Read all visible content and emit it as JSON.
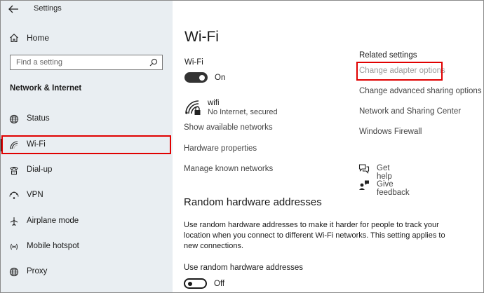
{
  "window": {
    "title": "Settings"
  },
  "sidebar": {
    "home_label": "Home",
    "search_placeholder": "Find a setting",
    "section_title": "Network & Internet",
    "items": [
      {
        "label": "Status",
        "icon": "globe-icon"
      },
      {
        "label": "Wi-Fi",
        "icon": "wifi-icon"
      },
      {
        "label": "Dial-up",
        "icon": "phone-icon"
      },
      {
        "label": "VPN",
        "icon": "vpn-icon"
      },
      {
        "label": "Airplane mode",
        "icon": "airplane-icon"
      },
      {
        "label": "Mobile hotspot",
        "icon": "hotspot-icon"
      },
      {
        "label": "Proxy",
        "icon": "globe-icon"
      }
    ],
    "selected_index": 1
  },
  "main": {
    "title": "Wi-Fi",
    "wifi_toggle_label": "Wi-Fi",
    "wifi_toggle_state": "On",
    "network": {
      "name": "wifi",
      "status": "No Internet, secured"
    },
    "links": [
      "Show available networks",
      "Hardware properties",
      "Manage known networks"
    ],
    "random": {
      "title": "Random hardware addresses",
      "description": "Use random hardware addresses to make it harder for people to track your location when you connect to different Wi-Fi networks. This setting applies to new connections.",
      "toggle_label": "Use random hardware addresses",
      "toggle_state": "Off"
    }
  },
  "related": {
    "title": "Related settings",
    "links": [
      "Change adapter options",
      "Change advanced sharing options",
      "Network and Sharing Center",
      "Windows Firewall"
    ],
    "help": [
      "Get help",
      "Give feedback"
    ]
  },
  "colors": {
    "highlight_border": "#e00000",
    "sidebar_bg": "#e9eef2",
    "toggle_on": "#333333"
  }
}
